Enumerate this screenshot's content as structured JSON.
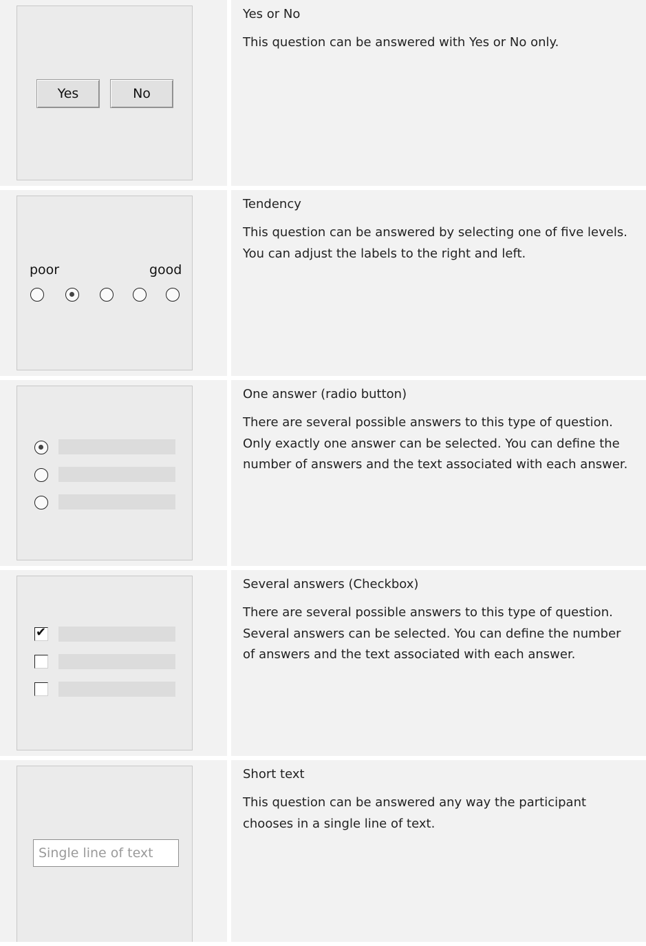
{
  "question_types": [
    {
      "title": "Yes or No",
      "description": "This question can be answered with Yes or No only.",
      "preview": {
        "yes_label": "Yes",
        "no_label": "No"
      }
    },
    {
      "title": "Tendency",
      "description": "This question can be answered by selecting one of five levels. You can adjust the labels to the right and left.",
      "preview": {
        "left_label": "poor",
        "right_label": "good",
        "levels": 5,
        "selected_level": 2
      }
    },
    {
      "title": "One answer (radio button)",
      "description": "There are several possible answers to this type of question. Only exactly one answer can be selected. You can define the number of answers and the text associated with each answer.",
      "preview": {
        "options": 3,
        "selected_option": 1
      }
    },
    {
      "title": "Several answers (Checkbox)",
      "description": "There are several possible answers to this type of question. Several answers can be selected. You can define the number of answers and the text associated with each answer.",
      "preview": {
        "options": 3,
        "checked_options": [
          1
        ]
      }
    },
    {
      "title": "Short text",
      "description": "This question can be answered any way the participant chooses in a single line of text.",
      "preview": {
        "placeholder": "Single line of text"
      }
    }
  ],
  "colors": {
    "cell_background": "#f2f2f2",
    "preview_background": "#ebebeb",
    "text": "#222222"
  }
}
